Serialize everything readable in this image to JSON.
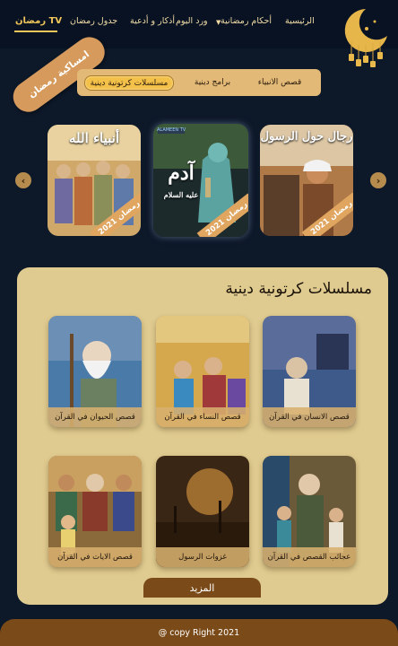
{
  "nav": {
    "brand": "رمضان TV",
    "items": [
      "الرئيسية",
      "أحكام رمضانية",
      "ورد اليوم",
      "أذكار و أدعية",
      "جدول رمضان"
    ]
  },
  "ribbon_text": "امساكية رمضان",
  "tabs": [
    "قصص الانبياء",
    "برامج دينية",
    "مسلسلات كرتونية دينية"
  ],
  "carousel": {
    "prev": "‹",
    "next": "›",
    "cards": [
      {
        "title": "أنبياء الله",
        "badge": "رمضان 2021"
      },
      {
        "title": "آدم",
        "subtitle": "عليه السلام",
        "channel": "ALAMEEN TV",
        "badge": "رمضان 2021"
      },
      {
        "title": "رجال حول الرسول",
        "badge": "رمضان 2021"
      }
    ]
  },
  "series": {
    "title": "مسلسلات كرتونية دينية",
    "items": [
      {
        "label": "قصص الانسان في القرآن"
      },
      {
        "label": "قصص النساء في القرآن"
      },
      {
        "label": "قصص الحيوان في القرآن"
      },
      {
        "label": "عجائب القصص في القرآن"
      },
      {
        "label": "غزوات الرسول"
      },
      {
        "label": "قصص الايات في القرآن"
      }
    ],
    "more_label": "المزيد"
  },
  "footer": "@ copy Right 2021",
  "colors": {
    "background": "#0d1829",
    "accent_gold": "#f1c65a",
    "tab_bar": "#e3b977",
    "panel": "#dfca8f",
    "brown": "#7a4a18"
  }
}
